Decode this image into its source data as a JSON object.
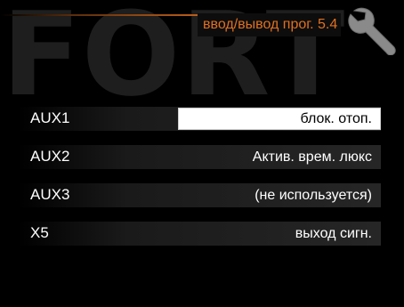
{
  "watermark": "FORT",
  "header": {
    "title": "ввод/вывод прог. 5.4",
    "icon": "wrench-icon"
  },
  "colors": {
    "accent": "#e07020",
    "background": "#000000",
    "text": "#ffffff"
  },
  "rows": [
    {
      "label": "AUX1",
      "value": "блок. отоп.",
      "selected": true
    },
    {
      "label": "AUX2",
      "value": "Актив. врем. люкс",
      "selected": false
    },
    {
      "label": "AUX3",
      "value": "(не используется)",
      "selected": false
    },
    {
      "label": "X5",
      "value": "выход сигн.",
      "selected": false
    }
  ]
}
